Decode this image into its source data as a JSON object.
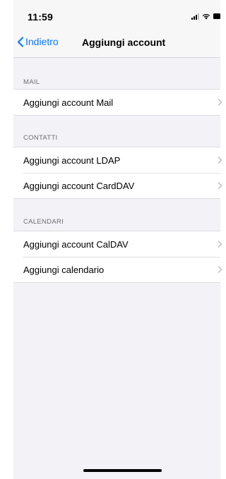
{
  "status_bar": {
    "time": "11:59"
  },
  "nav": {
    "back_label": "Indietro",
    "title": "Aggiungi account"
  },
  "sections": [
    {
      "header": "MAIL",
      "items": [
        {
          "label": "Aggiungi account Mail"
        }
      ]
    },
    {
      "header": "CONTATTI",
      "items": [
        {
          "label": "Aggiungi account LDAP"
        },
        {
          "label": "Aggiungi account CardDAV"
        }
      ]
    },
    {
      "header": "CALENDARI",
      "items": [
        {
          "label": "Aggiungi account CalDAV"
        },
        {
          "label": "Aggiungi calendario"
        }
      ]
    }
  ],
  "colors": {
    "accent": "#0a7aff",
    "background": "#f2f2f7"
  },
  "icons": [
    "back-chevron-icon",
    "signal-icon",
    "wifi-icon",
    "battery-icon",
    "chevron-right-icon"
  ]
}
